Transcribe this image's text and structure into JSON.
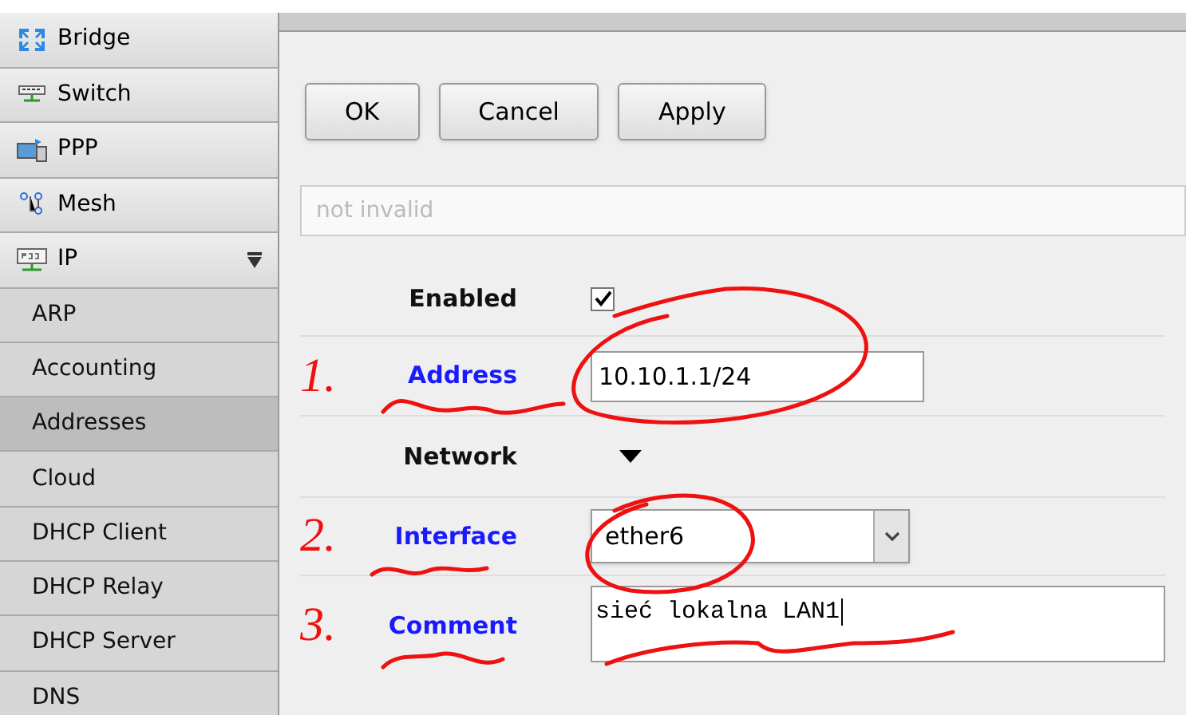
{
  "sidebar": {
    "items": [
      {
        "label": "Bridge",
        "selected": false
      },
      {
        "label": "Switch",
        "selected": false
      },
      {
        "label": "PPP",
        "selected": false
      },
      {
        "label": "Mesh",
        "selected": false
      },
      {
        "label": "IP",
        "selected": false,
        "expanded": true,
        "children": [
          {
            "label": "ARP",
            "selected": false
          },
          {
            "label": "Accounting",
            "selected": false
          },
          {
            "label": "Addresses",
            "selected": true
          },
          {
            "label": "Cloud",
            "selected": false
          },
          {
            "label": "DHCP Client",
            "selected": false
          },
          {
            "label": "DHCP Relay",
            "selected": false
          },
          {
            "label": "DHCP Server",
            "selected": false
          },
          {
            "label": "DNS",
            "selected": false
          }
        ]
      }
    ]
  },
  "buttons": [
    "OK",
    "Cancel",
    "Apply"
  ],
  "status_field": {
    "placeholder": "not invalid"
  },
  "form": {
    "rows": [
      {
        "kind": "checkbox",
        "label": "Enabled",
        "link": false,
        "checked": true
      },
      {
        "kind": "text",
        "label": "Address",
        "link": true,
        "value": "10.10.1.1/24",
        "annotation": "1."
      },
      {
        "kind": "section",
        "label": "Network",
        "link": false,
        "expanded": true
      },
      {
        "kind": "select",
        "label": "Interface",
        "link": true,
        "value": "ether6",
        "annotation": "2."
      },
      {
        "kind": "textarea",
        "label": "Comment",
        "link": true,
        "value": "sieć lokalna LAN1",
        "annotation": "3."
      }
    ]
  }
}
